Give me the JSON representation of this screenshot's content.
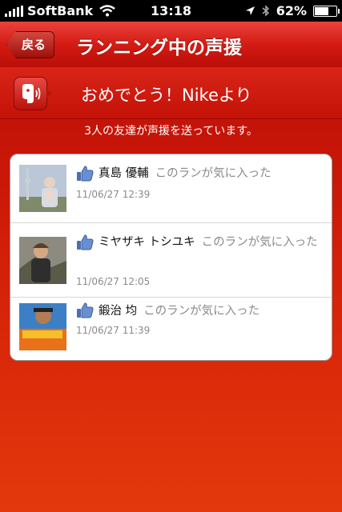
{
  "status_bar": {
    "carrier": "SoftBank",
    "time": "13:18",
    "battery": "62%",
    "icons": [
      "signal-icon",
      "wifi-icon",
      "location-icon",
      "bluetooth-icon",
      "battery-icon"
    ]
  },
  "nav": {
    "back_label": "戻る",
    "title": "ランニング中の声援"
  },
  "banner": {
    "icon": "cheer-speaker-icon",
    "text": "おめでとう！Nikeより"
  },
  "subtitle": "3人の友達が声援を送っています。",
  "cheers": [
    {
      "name": "真島 優輔",
      "message": "このランが気に入った",
      "timestamp": "11/06/27  12:39"
    },
    {
      "name": "ミヤザキ トシユキ",
      "message": "このランが気に入った",
      "timestamp": "11/06/27  12:05"
    },
    {
      "name": "鍛治 均",
      "message": "このランが気に入った",
      "timestamp": "11/06/27  11:39"
    }
  ],
  "colors": {
    "accent_red": "#c81608",
    "like_blue": "#4a6fb5",
    "muted_text": "#8a8a8a"
  }
}
